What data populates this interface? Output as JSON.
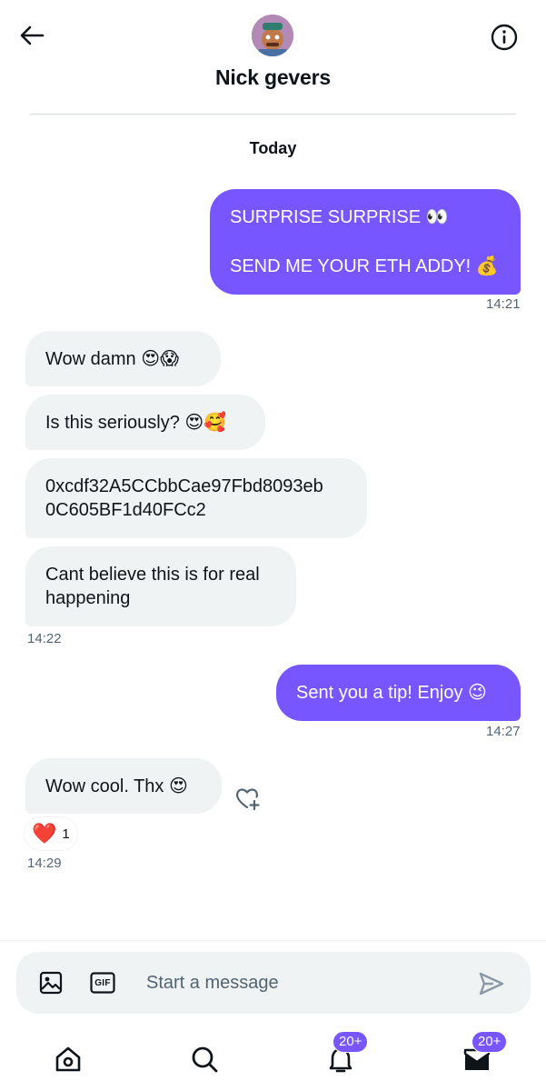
{
  "header": {
    "contact_name": "Nick gevers",
    "back_icon": "arrow-left-icon",
    "info_icon": "info-circle-icon"
  },
  "conversation": {
    "date_label": "Today",
    "messages": [
      {
        "side": "sent",
        "lines": [
          "SURPRISE SURPRISE 👀",
          "SEND ME YOUR ETH ADDY! 💰"
        ],
        "time": "14:21"
      },
      {
        "side": "received",
        "text": "Wow damn 😍😱"
      },
      {
        "side": "received",
        "text": "Is this seriously? 😍🥰"
      },
      {
        "side": "received",
        "lines": [
          "0xcdf32A5CCbbCae97Fbd8093eb",
          "0C605BF1d40FCc2"
        ]
      },
      {
        "side": "received",
        "lines": [
          "Cant believe this is for real",
          "happening"
        ],
        "time": "14:22"
      },
      {
        "side": "sent",
        "text": "Sent you a tip! Enjoy 😉",
        "time": "14:27"
      },
      {
        "side": "received",
        "text": "Wow cool. Thx 😍",
        "time": "14:29",
        "reaction": {
          "emoji": "❤️",
          "count": "1"
        }
      }
    ]
  },
  "composer": {
    "placeholder": "Start a message",
    "gif_label": "GIF"
  },
  "nav": {
    "notifications_badge": "20+",
    "messages_badge": "20+"
  },
  "colors": {
    "sent_bubble": "#7856ff",
    "received_bubble": "#eff3f4",
    "badge": "#7856ff",
    "muted_text": "#536471"
  }
}
